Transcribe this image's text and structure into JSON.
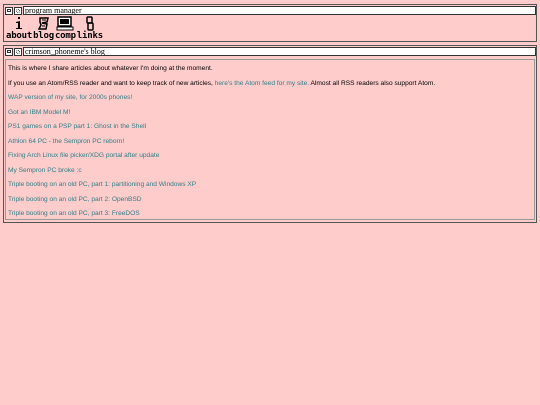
{
  "program_manager": {
    "title": "program manager",
    "tools": [
      {
        "label": "about",
        "icon": "info-icon"
      },
      {
        "label": "blog",
        "icon": "scroll-icon"
      },
      {
        "label": "comp",
        "icon": "computer-icon"
      },
      {
        "label": "links",
        "icon": "chain-link-icon"
      }
    ]
  },
  "blog": {
    "title": "crimson_phoneme's blog",
    "intro": "This is where I share articles about whatever I'm doing at the moment.",
    "feed_prefix": "If you use an Atom/RSS reader and want to keep track of new articles, ",
    "feed_link": "here's the Atom feed for my site.",
    "feed_suffix": " Almost all RSS readers also support Atom.",
    "articles": [
      "WAP version of my site, for 2000s phones!",
      "Got an IBM Model M!",
      "PS1 games on a PSP part 1: Ghost in the Shell",
      "Athlon 64 PC - the Sempron PC reborn!",
      "Fixing Arch Linux file picker/XDG portal after update",
      "My Sempron PC broke :c",
      "Triple booting on an old PC, part 1: partitioning and Windows XP",
      "Triple booting on an old PC, part 2: OpenBSD",
      "Triple booting on an old PC, part 3: FreeDOS"
    ]
  },
  "colors": {
    "background": "#ffcccc",
    "link": "#2e7f87",
    "border": "#555555"
  }
}
